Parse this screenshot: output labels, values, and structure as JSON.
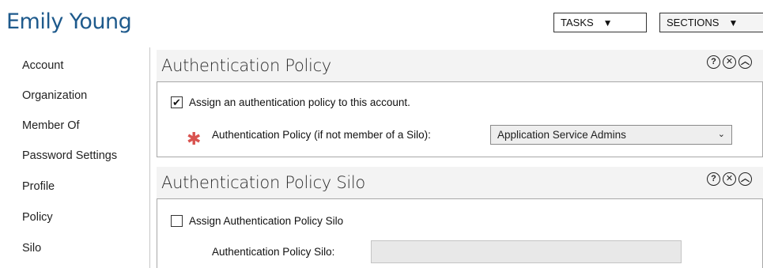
{
  "header": {
    "title": "Emily Young",
    "tasks_label": "TASKS",
    "sections_label": "SECTIONS"
  },
  "nav": {
    "items": [
      {
        "label": "Account"
      },
      {
        "label": "Organization"
      },
      {
        "label": "Member Of"
      },
      {
        "label": "Password Settings"
      },
      {
        "label": "Profile"
      },
      {
        "label": "Policy"
      },
      {
        "label": "Silo"
      }
    ]
  },
  "auth_policy": {
    "title": "Authentication Policy",
    "checkbox_label": "Assign an authentication policy to this account.",
    "checkbox_checked": true,
    "field_label": "Authentication Policy (if not member of a Silo):",
    "selected_value": "Application Service Admins"
  },
  "auth_silo": {
    "title": "Authentication Policy Silo",
    "checkbox_label": "Assign Authentication Policy Silo",
    "checkbox_checked": false,
    "field_label": "Authentication Policy Silo:",
    "field_value": ""
  },
  "icons": {
    "help": "help-icon",
    "close": "close-icon",
    "collapse": "collapse-icon",
    "dropdown": "triangle-down-icon",
    "required": "asterisk-icon"
  },
  "colors": {
    "title": "#1e5a8c",
    "required": "#d9534f",
    "section_header_bg": "#f3f3f3"
  }
}
